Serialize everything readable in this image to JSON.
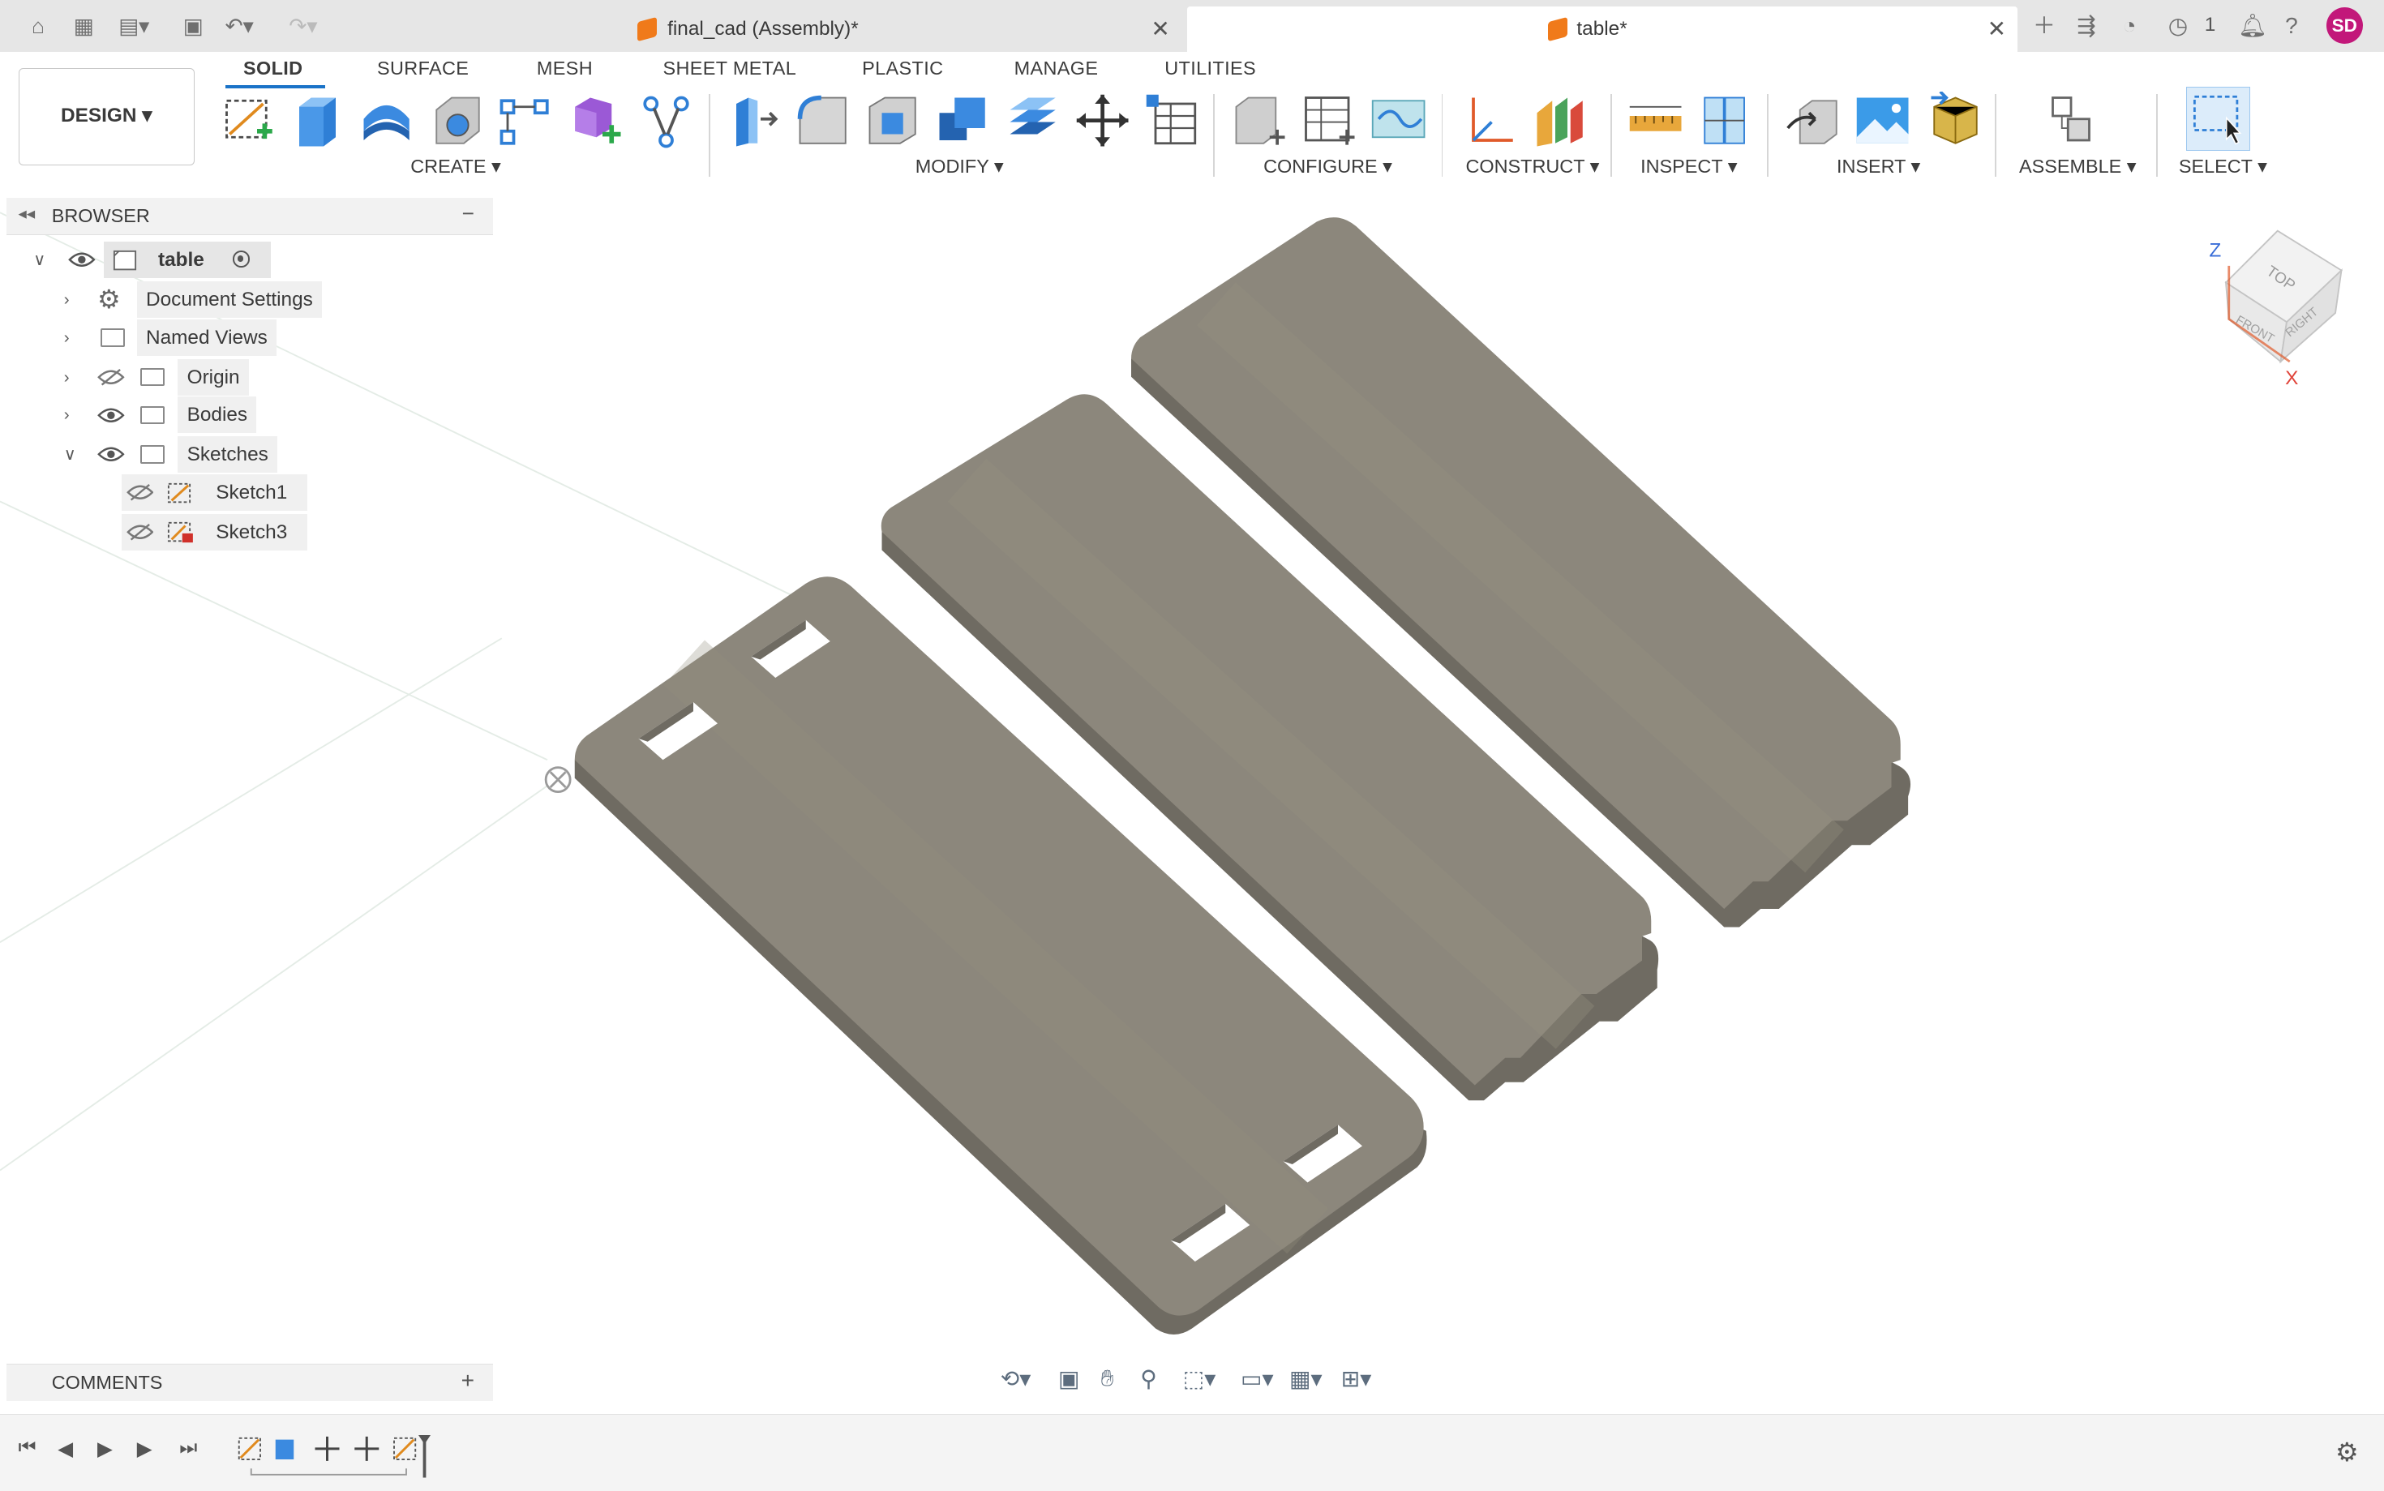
{
  "window": {
    "tabs": [
      {
        "title": "final_cad (Assembly)*",
        "active": false
      },
      {
        "title": "table*",
        "active": true
      }
    ],
    "user_initials": "SD",
    "job_count": "1"
  },
  "toolbar": {
    "workspace_button": "DESIGN ▾",
    "workspace_tabs": [
      "SOLID",
      "SURFACE",
      "MESH",
      "SHEET METAL",
      "PLASTIC",
      "MANAGE",
      "UTILITIES"
    ],
    "groups": [
      "CREATE ▾",
      "MODIFY ▾",
      "CONFIGURE ▾",
      "CONSTRUCT ▾",
      "INSPECT ▾",
      "INSERT ▾",
      "ASSEMBLE ▾",
      "SELECT ▾"
    ]
  },
  "browser": {
    "title": "BROWSER",
    "root": "table",
    "items": [
      {
        "label": "Document Settings"
      },
      {
        "label": "Named Views"
      },
      {
        "label": "Origin"
      },
      {
        "label": "Bodies"
      },
      {
        "label": "Sketches"
      }
    ],
    "sketches": [
      "Sketch1",
      "Sketch3"
    ]
  },
  "comments": {
    "title": "COMMENTS"
  },
  "viewcube": {
    "top": "TOP",
    "front": "FRONT",
    "right": "RIGHT",
    "axis_x": "X",
    "axis_z": "Z"
  },
  "colors": {
    "body": "#8c877c",
    "body_side": "#6b675e",
    "accent": "#1a73c8",
    "avatar": "#c2187a"
  }
}
